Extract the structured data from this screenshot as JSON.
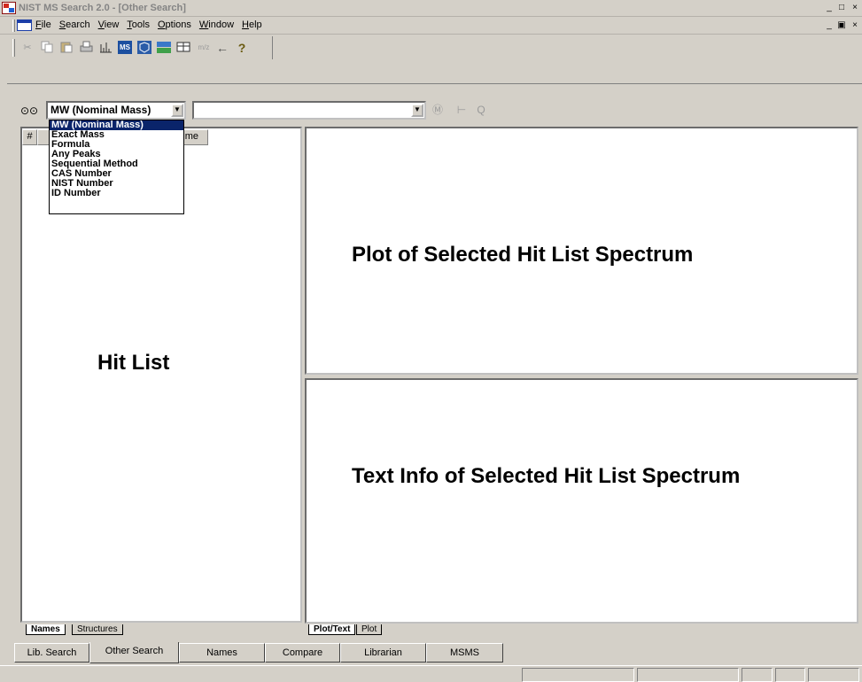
{
  "window": {
    "title": "NIST MS Search 2.0 - [Other Search]",
    "min_glyph": "_",
    "max_glyph": "□",
    "close_glyph": "×",
    "mdi_restore_glyph": "▣"
  },
  "menu": [
    {
      "acc": "F",
      "rest": "ile"
    },
    {
      "acc": "S",
      "rest": "earch"
    },
    {
      "acc": "V",
      "rest": "iew"
    },
    {
      "acc": "T",
      "rest": "ools"
    },
    {
      "acc": "O",
      "rest": "ptions"
    },
    {
      "acc": "W",
      "rest": "indow"
    },
    {
      "acc": "H",
      "rest": "elp"
    }
  ],
  "toolbar": {
    "mz_label": "m/z",
    "back_arrow": "←",
    "help_glyph": "?",
    "icons": [
      "scissors-icon",
      "copy-icon",
      "paste-icon",
      "print-icon",
      "spectrum-icon",
      "ms-icon",
      "structure-icon",
      "compare-icon",
      "table-icon",
      "mz-icon",
      "back-arrow-icon",
      "help-icon"
    ]
  },
  "search": {
    "type_value": "MW (Nominal Mass)",
    "options": [
      "MW (Nominal Mass)",
      "Exact Mass",
      "Formula",
      "Any Peaks",
      "Sequential Method",
      "CAS Number",
      "NIST Number",
      "ID Number"
    ],
    "selected_index": 0,
    "value": "",
    "binoculars_glyph": "⊙⊙",
    "go_glyph": "Ⓜ",
    "tree_glyph": "⊢",
    "zoom_glyph": "Q"
  },
  "hitlist": {
    "col_number": "#",
    "col_name_visible": "me",
    "label": "Hit List",
    "tabs": [
      "Names",
      "Structures"
    ],
    "active_tab": 0
  },
  "plot_pane": {
    "label": "Plot of Selected Hit List Spectrum"
  },
  "text_pane": {
    "label": "Text Info of Selected Hit List Spectrum",
    "tabs": [
      "Plot/Text",
      "Plot"
    ],
    "active_tab": 0
  },
  "mode_tabs": [
    "Lib. Search",
    "Other Search",
    "Names",
    "Compare",
    "Librarian",
    "MSMS"
  ],
  "active_mode": 1,
  "colors": {
    "selection": "#0a246a",
    "face": "#d4d0c8",
    "title_text": "#848484"
  }
}
